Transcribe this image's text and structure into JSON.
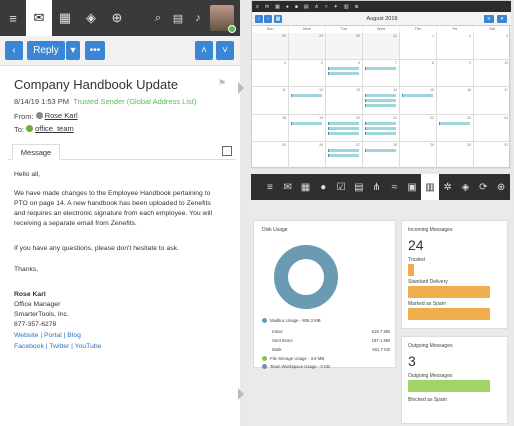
{
  "nav": {
    "menu_icon": "menu-icon",
    "icons": [
      "mail-icon",
      "calendar-icon",
      "layers-icon",
      "plus-circle-icon"
    ],
    "small_icons": [
      "search-icon",
      "chat-icon",
      "bell-icon"
    ]
  },
  "toolbar": {
    "reply_label": "Reply",
    "more_label": "•••"
  },
  "message": {
    "subject": "Company Handbook Update",
    "datetime": "8/14/19 1:53 PM",
    "trusted": "Trusted Sender (Global Address List)",
    "from_label": "From:",
    "from_name": "Rose Karl",
    "to_label": "To:",
    "to_name": "office_team",
    "tab_label": "Message",
    "greeting": "Hello all,",
    "para1_l1": "We have made changes to the Employee Handbook pertaining to",
    "para1_l2": "PTO on page 14.  A new handbook has been uploaded to Zenefits",
    "para1_l3": "and requires an electronic signature from each employee.  You will",
    "para1_l4": "receiving a separate email from Zenefits.",
    "para2": "If you have any questions, please don't hesitate to ask.",
    "thanks": "Thanks,",
    "sig_name": "Rose Karl",
    "sig_title": "Office Manager",
    "sig_company": "SmarterTools, Inc.",
    "sig_phone": "877-357-6278",
    "sig_links1": "Website | Portal | Blog",
    "sig_links2": "Facebook | Twitter | YouTube"
  },
  "calendar": {
    "month": "August 2019",
    "dows": [
      "Sun",
      "Mon",
      "Tue",
      "Wed",
      "Thu",
      "Fri",
      "Sat"
    ],
    "weeks": [
      [
        "28",
        "29",
        "30",
        "31",
        "1",
        "2",
        "3"
      ],
      [
        "4",
        "5",
        "6",
        "7",
        "8",
        "9",
        "10"
      ],
      [
        "11",
        "12",
        "13",
        "14",
        "15",
        "16",
        "17"
      ],
      [
        "18",
        "19",
        "20",
        "21",
        "22",
        "23",
        "24"
      ],
      [
        "25",
        "26",
        "27",
        "28",
        "29",
        "30",
        "31"
      ]
    ]
  },
  "dashboard": {
    "disk_title": "Disk Usage",
    "mailbox_usage": "Mailbox Usage - 806.3 MB",
    "rows": [
      {
        "label": "Inbox",
        "value": "618.7 MB"
      },
      {
        "label": "Sent Items",
        "value": "187.1 MB"
      },
      {
        "label": "Mark",
        "value": "501.7 KB"
      }
    ],
    "file_storage": "File Storage Usage - 3.9 MB",
    "team_workspace": "Team Workspace Usage - 0 KB",
    "incoming_title": "Incoming Messages",
    "incoming_count": "24",
    "incoming_bars": [
      {
        "label": "Trusted",
        "fraction": 0.06
      },
      {
        "label": "Standard Delivery",
        "fraction": 0.86
      },
      {
        "label": "Marked as Spam",
        "fraction": 0.86
      }
    ],
    "outgoing_title": "Outgoing Messages",
    "outgoing_count": "3",
    "outgoing_bars": [
      {
        "label": "Outgoing Messages",
        "fraction": 0.86
      },
      {
        "label": "Blocked as Spam",
        "fraction": 0
      }
    ],
    "colors": {
      "mailbox": "#6a9bb3",
      "file": "#8cc152",
      "team": "#7a8ba8",
      "bar": "#f0ad4e",
      "out": "#a0d468"
    }
  }
}
